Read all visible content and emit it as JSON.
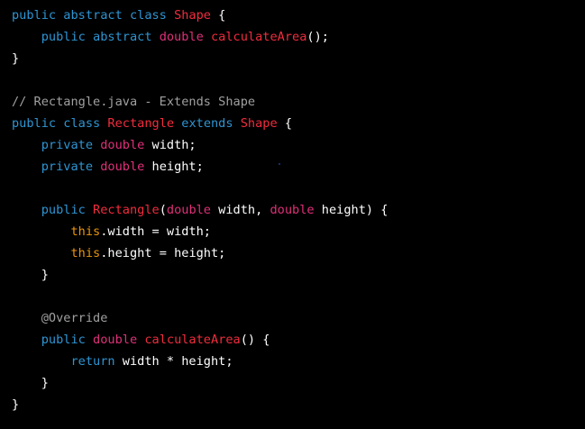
{
  "colors": {
    "background": "#000000",
    "plain": "#ffffff",
    "keyword": "#2e95d3",
    "type": "#df3079",
    "classname": "#f22c3d",
    "this": "#e9950c",
    "comment": "#a0a0a0",
    "annotation": "#a0a0a0",
    "dot": "#1a3a8a"
  },
  "lines": [
    {
      "tokens": [
        {
          "t": "public abstract class ",
          "k": "keyword"
        },
        {
          "t": "Shape",
          "k": "classname"
        },
        {
          "t": " {",
          "k": "plain"
        }
      ]
    },
    {
      "tokens": [
        {
          "t": "    public abstract ",
          "k": "keyword"
        },
        {
          "t": "double",
          "k": "type"
        },
        {
          "t": " ",
          "k": "plain"
        },
        {
          "t": "calculateArea",
          "k": "classname"
        },
        {
          "t": "();",
          "k": "plain"
        }
      ]
    },
    {
      "tokens": [
        {
          "t": "}",
          "k": "plain"
        }
      ]
    },
    {
      "tokens": []
    },
    {
      "tokens": [
        {
          "t": "// Rectangle.java - Extends Shape",
          "k": "comment"
        }
      ]
    },
    {
      "tokens": [
        {
          "t": "public class ",
          "k": "keyword"
        },
        {
          "t": "Rectangle",
          "k": "classname"
        },
        {
          "t": " ",
          "k": "plain"
        },
        {
          "t": "extends",
          "k": "keyword"
        },
        {
          "t": " ",
          "k": "plain"
        },
        {
          "t": "Shape",
          "k": "classname"
        },
        {
          "t": " {",
          "k": "plain"
        }
      ]
    },
    {
      "tokens": [
        {
          "t": "    private ",
          "k": "keyword"
        },
        {
          "t": "double",
          "k": "type"
        },
        {
          "t": " width;",
          "k": "plain"
        }
      ]
    },
    {
      "tokens": [
        {
          "t": "    private ",
          "k": "keyword"
        },
        {
          "t": "double",
          "k": "type"
        },
        {
          "t": " height;",
          "k": "plain"
        }
      ]
    },
    {
      "tokens": []
    },
    {
      "tokens": [
        {
          "t": "    public ",
          "k": "keyword"
        },
        {
          "t": "Rectangle",
          "k": "classname"
        },
        {
          "t": "(",
          "k": "plain"
        },
        {
          "t": "double",
          "k": "type"
        },
        {
          "t": " width, ",
          "k": "plain"
        },
        {
          "t": "double",
          "k": "type"
        },
        {
          "t": " height) {",
          "k": "plain"
        }
      ]
    },
    {
      "tokens": [
        {
          "t": "        ",
          "k": "plain"
        },
        {
          "t": "this",
          "k": "this"
        },
        {
          "t": ".width = width;",
          "k": "plain"
        }
      ]
    },
    {
      "tokens": [
        {
          "t": "        ",
          "k": "plain"
        },
        {
          "t": "this",
          "k": "this"
        },
        {
          "t": ".height = height;",
          "k": "plain"
        }
      ]
    },
    {
      "tokens": [
        {
          "t": "    }",
          "k": "plain"
        }
      ]
    },
    {
      "tokens": []
    },
    {
      "tokens": [
        {
          "t": "    @Override",
          "k": "annotation"
        }
      ]
    },
    {
      "tokens": [
        {
          "t": "    public ",
          "k": "keyword"
        },
        {
          "t": "double",
          "k": "type"
        },
        {
          "t": " ",
          "k": "plain"
        },
        {
          "t": "calculateArea",
          "k": "classname"
        },
        {
          "t": "() {",
          "k": "plain"
        }
      ]
    },
    {
      "tokens": [
        {
          "t": "        ",
          "k": "plain"
        },
        {
          "t": "return",
          "k": "keyword"
        },
        {
          "t": " width * height;",
          "k": "plain"
        }
      ]
    },
    {
      "tokens": [
        {
          "t": "    }",
          "k": "plain"
        }
      ]
    },
    {
      "tokens": [
        {
          "t": "}",
          "k": "plain"
        }
      ]
    }
  ]
}
